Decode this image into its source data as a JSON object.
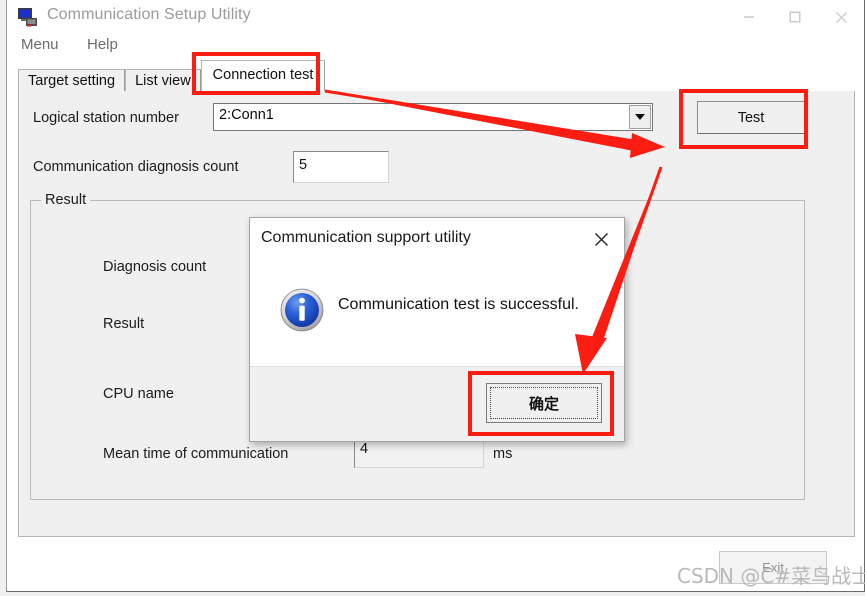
{
  "window": {
    "title": "Communication Setup Utility",
    "icon": "computer-network-icon",
    "controls": {
      "minimize": "–",
      "maximize": "□",
      "close": "✕"
    }
  },
  "menubar": {
    "items": [
      {
        "label": "Menu"
      },
      {
        "label": "Help"
      }
    ]
  },
  "tabs": [
    {
      "label": "Target setting",
      "selected": false
    },
    {
      "label": "List view",
      "selected": false
    },
    {
      "label": "Connection test",
      "selected": true
    }
  ],
  "form": {
    "logical_station_label": "Logical station number",
    "logical_station_value": "2:Conn1",
    "diagnosis_count_label": "Communication diagnosis count",
    "diagnosis_count_value": "5",
    "test_button": "Test"
  },
  "result": {
    "group_title": "Result",
    "rows": [
      {
        "label": "Diagnosis count",
        "value": ""
      },
      {
        "label": "Result",
        "value": ""
      },
      {
        "label": "CPU name",
        "value": ""
      },
      {
        "label": "Mean time of communication",
        "value": "4",
        "unit": "ms"
      }
    ]
  },
  "footer": {
    "exit_button": "Exit"
  },
  "dialog": {
    "title": "Communication support utility",
    "close_icon": "✕",
    "icon": "info-icon",
    "message": "Communication test is successful.",
    "ok_button": "确定"
  },
  "annotations": {
    "color": "#fb1c12",
    "boxes": [
      {
        "name": "connection-test-tab-highlight"
      },
      {
        "name": "test-button-highlight"
      },
      {
        "name": "ok-button-highlight"
      }
    ],
    "arrows": [
      {
        "name": "arrow-tab-to-test"
      },
      {
        "name": "arrow-test-to-ok"
      }
    ]
  },
  "watermark": {
    "text": "CSDN @C#菜鸟战士"
  }
}
